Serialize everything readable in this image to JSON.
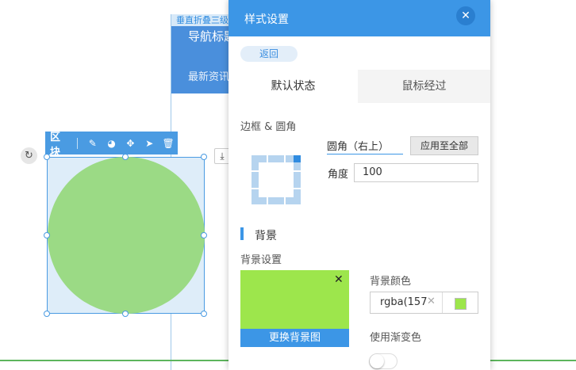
{
  "canvas": {
    "fold_label": "垂直折叠三级",
    "nav_title": "导航标题",
    "nav_subtitle": "最新资讯",
    "block_label": "区块"
  },
  "panel": {
    "title": "样式设置",
    "back_label": "返回",
    "tabs": [
      {
        "label": "默认状态",
        "active": true
      },
      {
        "label": "鼠标经过",
        "active": false
      }
    ],
    "border": {
      "section_label": "边框 & 圆角",
      "corner_selected": "圆角（右上）",
      "apply_label": "应用至全部",
      "angle_label": "角度",
      "angle_value": "100"
    },
    "background": {
      "section_title": "背景",
      "setting_label": "背景设置",
      "change_image_label": "更换背景图",
      "color_label": "背景颜色",
      "color_value": "rgba(157",
      "gradient_label": "使用渐变色",
      "gradient_on": false
    }
  },
  "colors": {
    "accent": "#3c96e6",
    "preview_bg": "#9de64c",
    "circle": "#9bda85",
    "nav_block": "#4a8fdc"
  },
  "icons": [
    "rotate-icon",
    "edit-icon",
    "style-icon",
    "move-icon",
    "send-icon",
    "delete-icon",
    "close-icon",
    "download-icon",
    "clear-icon"
  ]
}
